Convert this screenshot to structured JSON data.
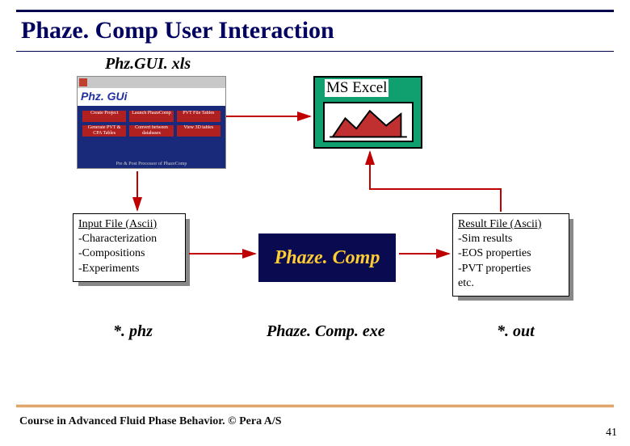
{
  "slide": {
    "title": "Phaze. Comp User Interaction",
    "footer": "Course in Advanced Fluid Phase Behavior. © Pera A/S",
    "page": "41"
  },
  "phzgui": {
    "file_label": "Phz.GUI. xls",
    "app_title": "Phz. GUi",
    "buttons": [
      "Create Project",
      "Launch PhazeComp",
      "PVT File Tables",
      "Generate PVT & CPA Tables",
      "Convert between databases",
      "View 3D tables"
    ],
    "caption": "Pre & Post Processor of PhazeComp"
  },
  "excel": {
    "label": "MS Excel"
  },
  "input_file": {
    "heading": "Input File (Ascii)",
    "items": [
      "-Characterization",
      "-Compositions",
      "-Experiments"
    ],
    "ext": "*. phz"
  },
  "engine": {
    "name": "Phaze. Comp",
    "exe": "Phaze. Comp. exe"
  },
  "result_file": {
    "heading": "Result File (Ascii)",
    "items": [
      "-Sim results",
      "-EOS properties",
      "-PVT properties",
      "etc."
    ],
    "ext": "*. out"
  }
}
